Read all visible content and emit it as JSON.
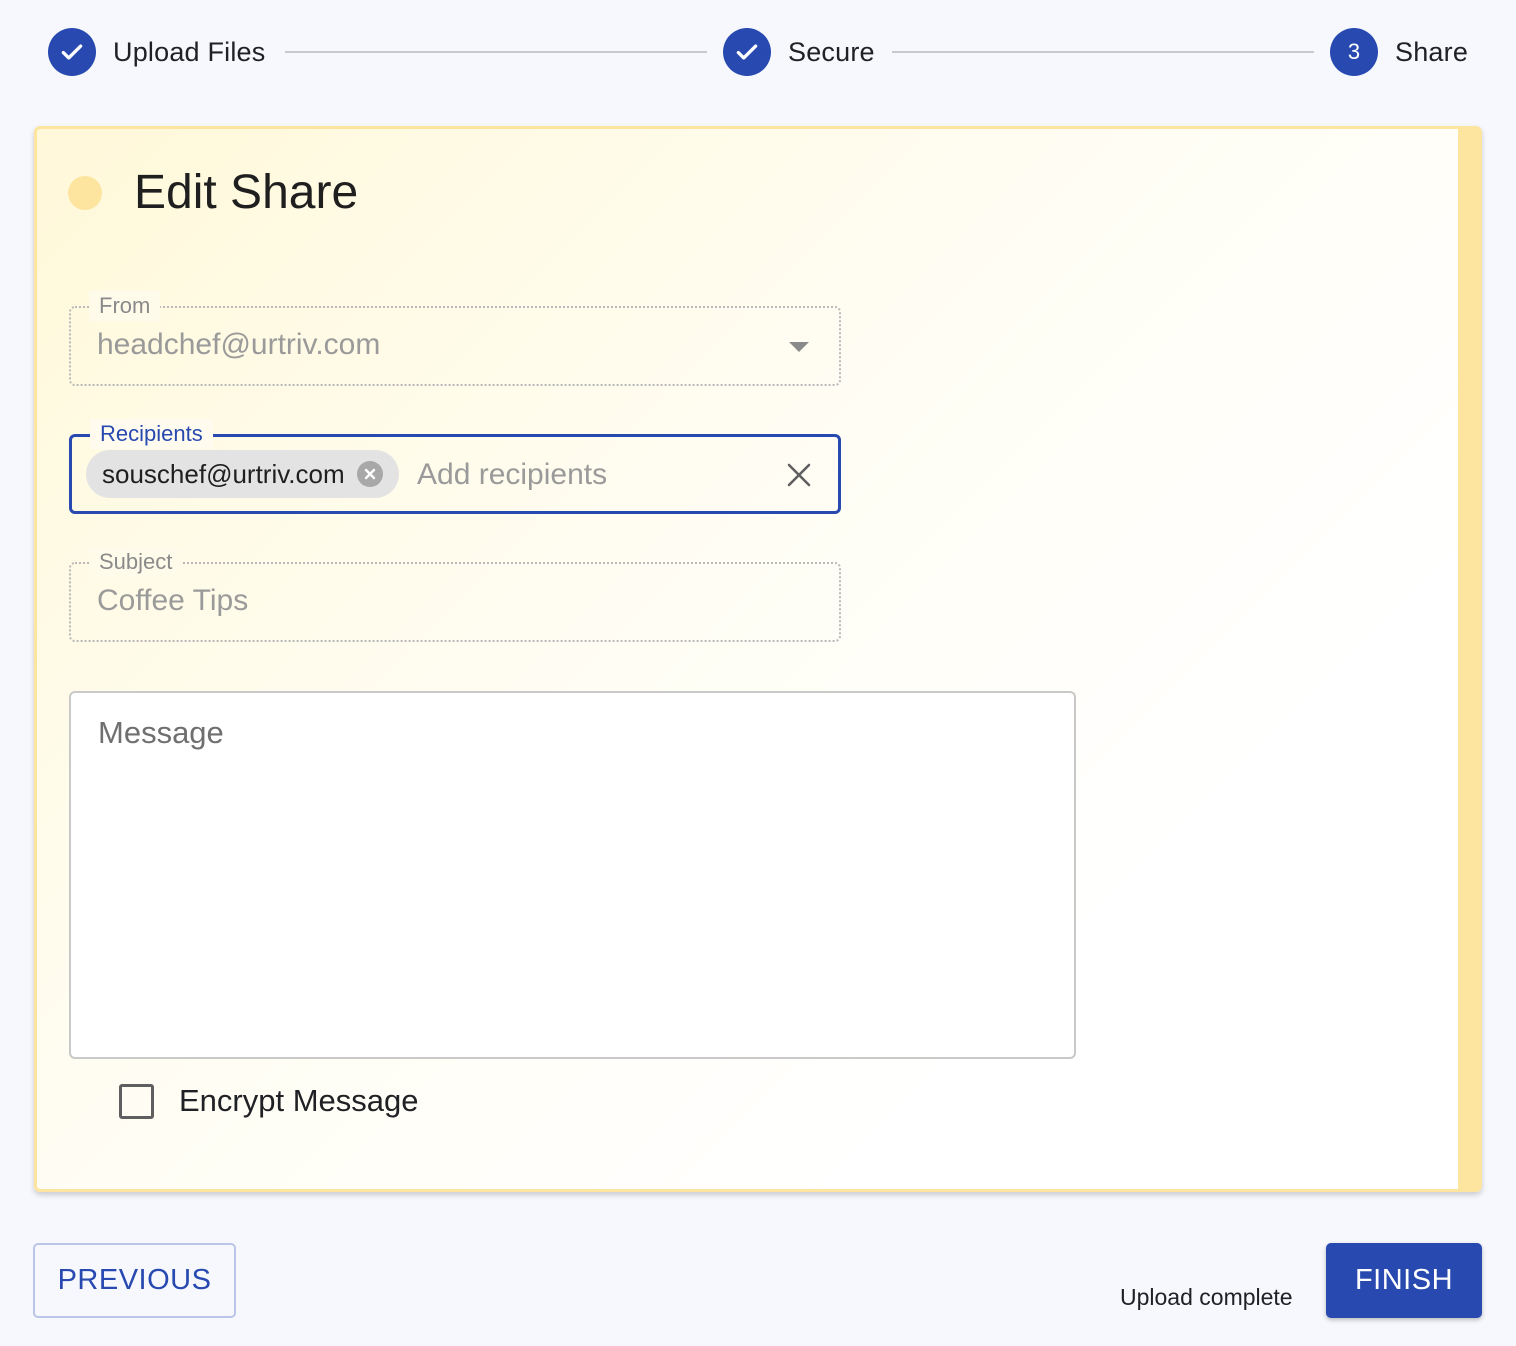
{
  "stepper": {
    "steps": [
      {
        "label": "Upload Files",
        "state": "complete",
        "icon": "check-icon"
      },
      {
        "label": "Secure",
        "state": "complete",
        "icon": "check-icon"
      },
      {
        "label": "Share",
        "state": "active",
        "number": "3"
      }
    ]
  },
  "card": {
    "title": "Edit Share",
    "accent_color": "#fde5a0"
  },
  "form": {
    "from": {
      "label": "From",
      "value": "headchef@urtriv.com",
      "icon": "chevron-down-icon"
    },
    "recipients": {
      "label": "Recipients",
      "chips": [
        {
          "label": "souschef@urtriv.com",
          "icon": "remove-chip-icon"
        }
      ],
      "placeholder": "Add recipients",
      "clear_icon": "close-icon"
    },
    "subject": {
      "label": "Subject",
      "value": "Coffee Tips"
    },
    "message": {
      "placeholder": "Message"
    },
    "encrypt": {
      "label": "Encrypt Message",
      "checked": false
    }
  },
  "footer": {
    "previous_label": "PREVIOUS",
    "status": "Upload complete",
    "finish_label": "FINISH"
  },
  "colors": {
    "primary": "#2749b0",
    "background": "#f6f8fd"
  }
}
